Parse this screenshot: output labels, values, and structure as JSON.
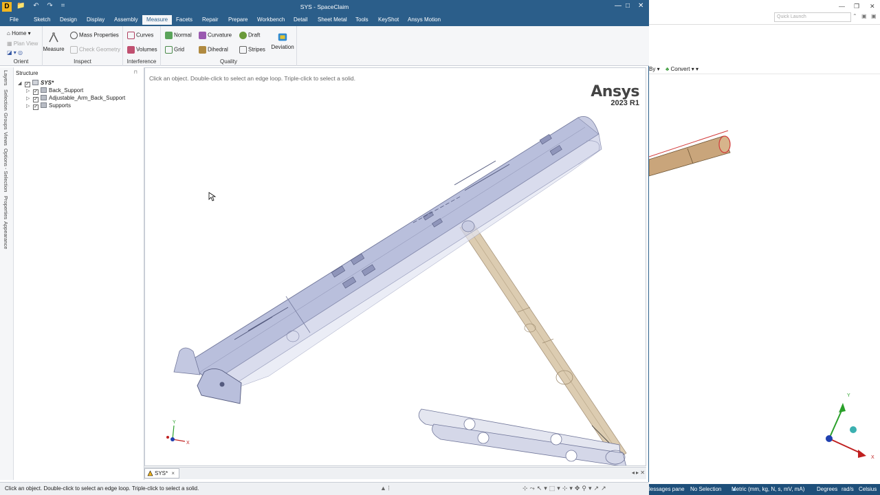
{
  "app": {
    "title": "SYS - SpaceClaim",
    "logo_letter": "D"
  },
  "window_buttons": {
    "minimize": "—",
    "maximize": "□",
    "close": "✕"
  },
  "quick_access": [
    "📁",
    "↶",
    "↷",
    "="
  ],
  "menu": [
    "File",
    "Sketch",
    "Design",
    "Display",
    "Assembly",
    "Measure",
    "Facets",
    "Repair",
    "Prepare",
    "Workbench",
    "Detail",
    "Sheet Metal",
    "Tools",
    "KeyShot",
    "Ansys Motion"
  ],
  "menu_active": "Measure",
  "ribbon": {
    "orient": {
      "label": "Orient",
      "home": "Home",
      "plan_view": "Plan View"
    },
    "inspect": {
      "label": "Inspect",
      "measure": "Measure",
      "mass_properties": "Mass Properties",
      "check_geometry": "Check Geometry"
    },
    "interference": {
      "label": "Interference",
      "curves": "Curves",
      "volumes": "Volumes"
    },
    "quality": {
      "label": "Quality",
      "normal": "Normal",
      "grid": "Grid",
      "curvature": "Curvature",
      "dihedral": "Dihedral",
      "draft": "Draft",
      "stripes": "Stripes",
      "deviation": "Deviation"
    }
  },
  "side_tabs": [
    "Layers",
    "Selection",
    "Groups",
    "Views",
    "Options - Selection",
    "Properties",
    "Appearance"
  ],
  "structure": {
    "title": "Structure",
    "root": "SYS*",
    "children": [
      "Back_Support",
      "Adjustable_Arm_Back_Support",
      "Supports"
    ]
  },
  "viewport": {
    "hint": "Click an object. Double-click to select an edge loop. Triple-click to select a solid.",
    "brand": "Ansys",
    "version": "2023 R1",
    "triad": {
      "x": "X",
      "y": "Y"
    }
  },
  "doc_tab": {
    "label": "SYS*",
    "close": "×"
  },
  "status": {
    "text": "Click an object. Double-click to select an edge loop. Triple-click to select a solid."
  },
  "background_window": {
    "quick_launch_placeholder": "Quick Launch",
    "by_label": "By",
    "convert_label": "Convert",
    "status_items": [
      "lessages pane",
      "No Selection",
      "Metric (mm, kg, N, s, mV, mA)",
      "Degrees",
      "rad/s",
      "Celsius"
    ],
    "triad": {
      "x": "X",
      "y": "Y"
    }
  },
  "colors": {
    "title_bar": "#2b5e8a",
    "ribbon_bg": "#f5f6f8",
    "part_fill": "#b9bfdc",
    "arm_fill": "#d8c6a8",
    "status_bg_right": "#1e4f7a"
  }
}
